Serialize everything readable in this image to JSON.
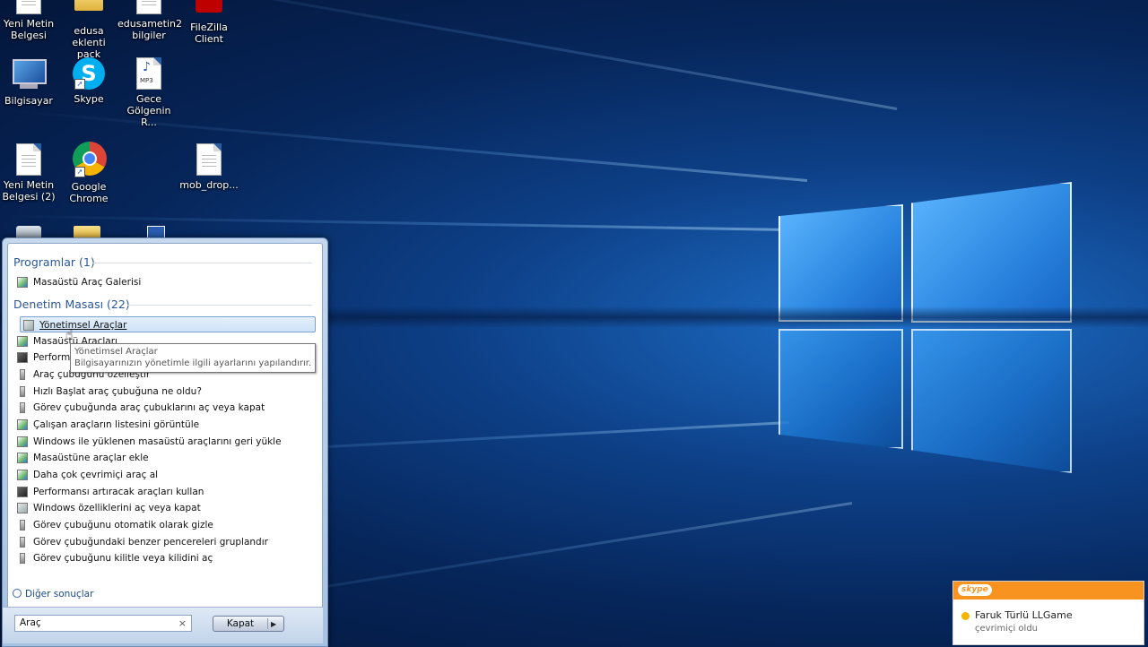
{
  "desktop_icons": [
    {
      "label": "Yeni Metin\nBelgesi",
      "icon": "text-file-icon"
    },
    {
      "label": "edusa eklenti\npack",
      "icon": "folder-icon"
    },
    {
      "label": "edusametin2\nbilgiler",
      "icon": "text-file-icon"
    },
    {
      "label": "FileZilla\nClient",
      "icon": "filezilla-icon"
    },
    {
      "label": "Bilgisayar",
      "icon": "computer-icon"
    },
    {
      "label": "Skype",
      "icon": "skype-icon"
    },
    {
      "label": "Gece\nGölgenin R...",
      "icon": "mp3-icon"
    },
    {
      "label": "Yeni Metin\nBelgesi (2)",
      "icon": "text-file-icon"
    },
    {
      "label": "Google\nChrome",
      "icon": "chrome-icon"
    },
    {
      "label": "mob_drop...",
      "icon": "text-file-icon"
    }
  ],
  "start_search": {
    "group_programs": "Programlar (1)",
    "programs": [
      "Masaüstü Araç Galerisi"
    ],
    "group_control_panel": "Denetim Masası (22)",
    "control_items": [
      "Yönetimsel Araçlar",
      "Masaüstü Araçları",
      "Performans Bilgileri ve Araçları",
      "Araç çubuğunu özelleştir",
      "Hızlı Başlat araç çubuğuna ne oldu?",
      "Görev çubuğunda araç çubuklarını aç veya kapat",
      "Çalışan araçların listesini görüntüle",
      "Windows ile yüklenen masaüstü araçlarını geri yükle",
      "Masaüstüne araçlar ekle",
      "Daha çok çevrimiçi araç al",
      "Performansı artıracak araçları kullan",
      "Windows özelliklerini aç veya kapat",
      "Görev çubuğunu otomatik olarak gizle",
      "Görev çubuğundaki benzer pencereleri gruplandır",
      "Görev çubuğunu kilitle veya kilidini aç"
    ],
    "tooltip_title": "Yönetimsel Araçlar",
    "tooltip_desc": "Bilgisayarınızın yönetimle ilgili ayarlarını yapılandırır.",
    "more_results": "Diğer sonuçlar",
    "search_value": "Araç",
    "shutdown_label": "Kapat"
  },
  "notification": {
    "app": "skype",
    "name": "Faruk Türlü LLGame",
    "status": "çevrimiçi oldu"
  }
}
